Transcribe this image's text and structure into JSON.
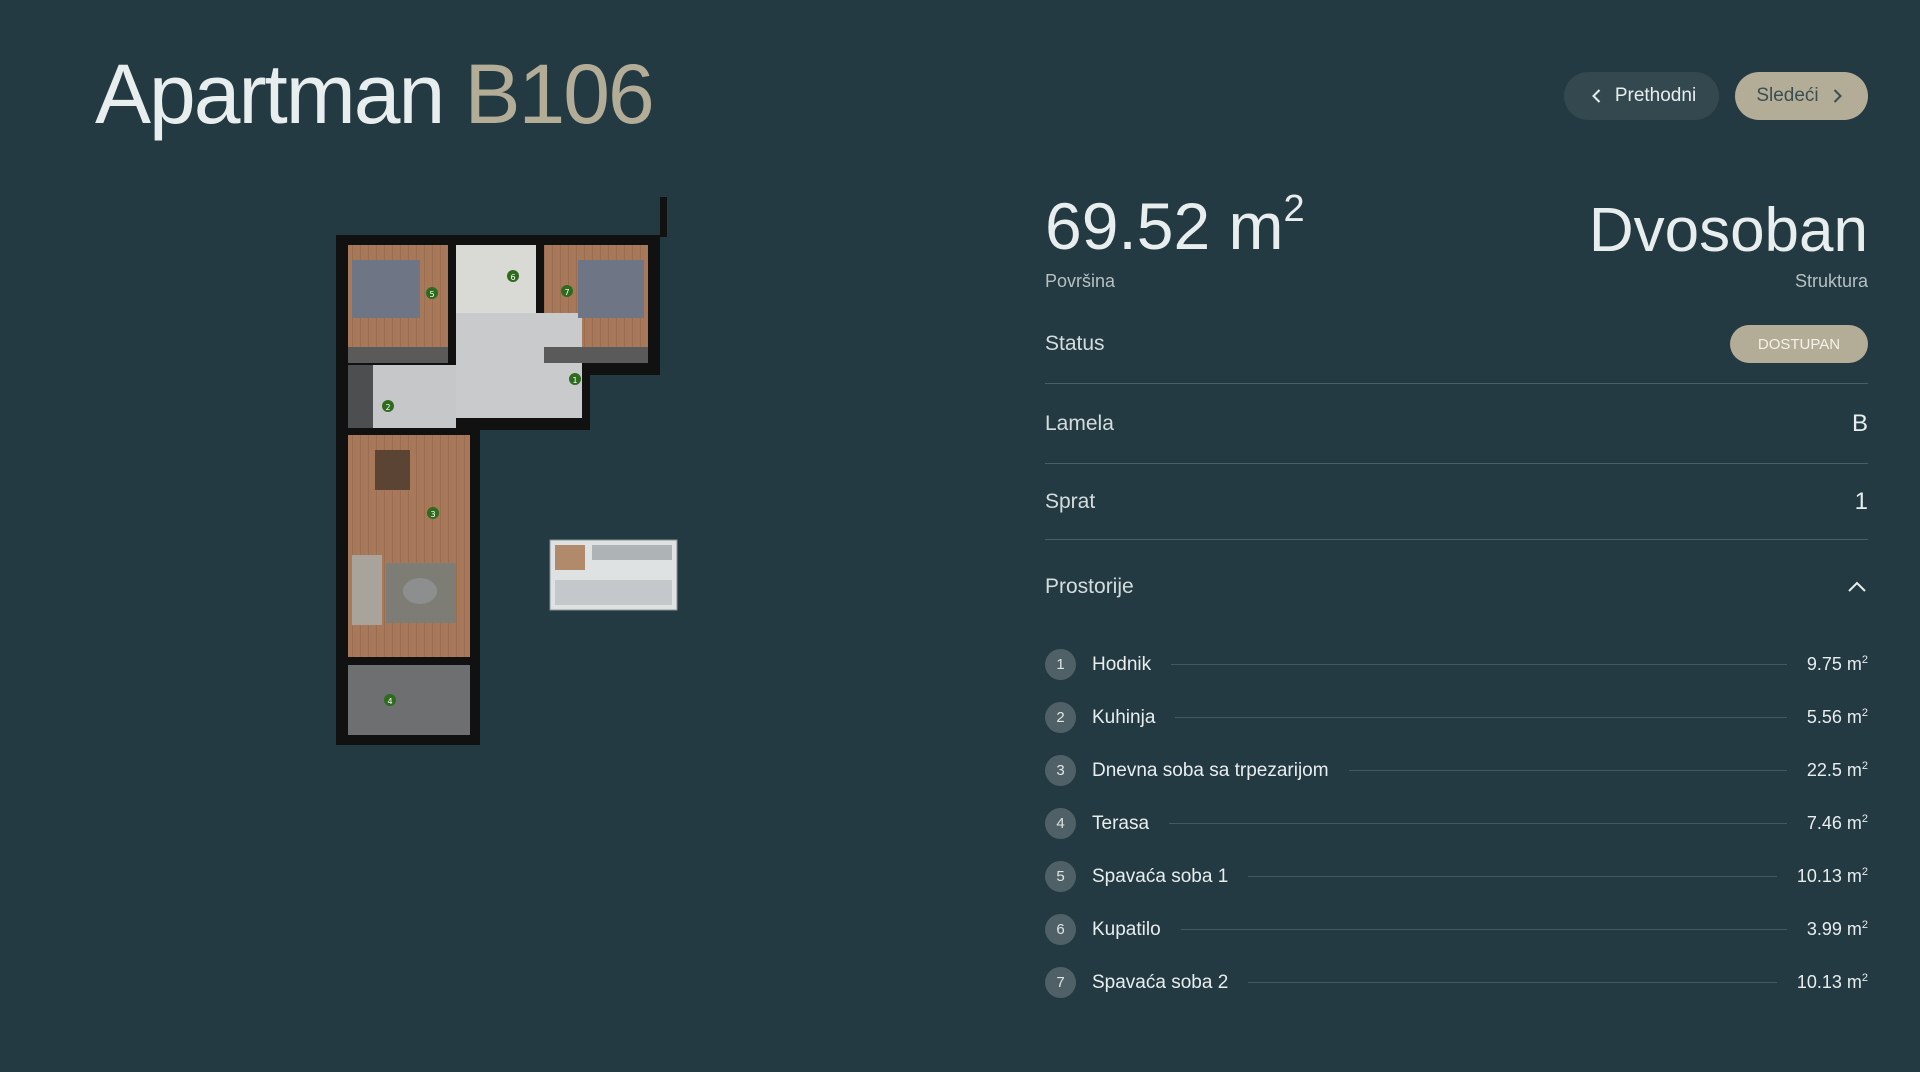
{
  "header": {
    "title_word": "Apartman",
    "title_code": "B106",
    "prev_label": "Prethodni",
    "next_label": "Sledeći"
  },
  "summary": {
    "area_value": "69.52 m",
    "area_exp": "2",
    "area_label": "Površina",
    "structure_value": "Dvosoban",
    "structure_label": "Struktura"
  },
  "details": {
    "status_label": "Status",
    "status_value": "DOSTUPAN",
    "lamela_label": "Lamela",
    "lamela_value": "B",
    "sprat_label": "Sprat",
    "sprat_value": "1",
    "rooms_label": "Prostorije"
  },
  "rooms": [
    {
      "num": "1",
      "name": "Hodnik",
      "size": "9.75 m",
      "exp": "2"
    },
    {
      "num": "2",
      "name": "Kuhinja",
      "size": "5.56 m",
      "exp": "2"
    },
    {
      "num": "3",
      "name": "Dnevna soba sa trpezarijom",
      "size": "22.5 m",
      "exp": "2"
    },
    {
      "num": "4",
      "name": "Terasa",
      "size": "7.46 m",
      "exp": "2"
    },
    {
      "num": "5",
      "name": "Spavaća soba 1",
      "size": "10.13 m",
      "exp": "2"
    },
    {
      "num": "6",
      "name": "Kupatilo",
      "size": "3.99 m",
      "exp": "2"
    },
    {
      "num": "7",
      "name": "Spavaća soba 2",
      "size": "10.13 m",
      "exp": "2"
    }
  ],
  "plan_markers": [
    "1",
    "2",
    "3",
    "4",
    "5",
    "6",
    "7"
  ],
  "colors": {
    "background": "#233a42",
    "accent": "#b3ad98",
    "marker": "#2f6b1e"
  },
  "icons": {
    "prev": "chevron-left-icon",
    "next": "chevron-right-icon",
    "collapse": "chevron-up-icon"
  }
}
